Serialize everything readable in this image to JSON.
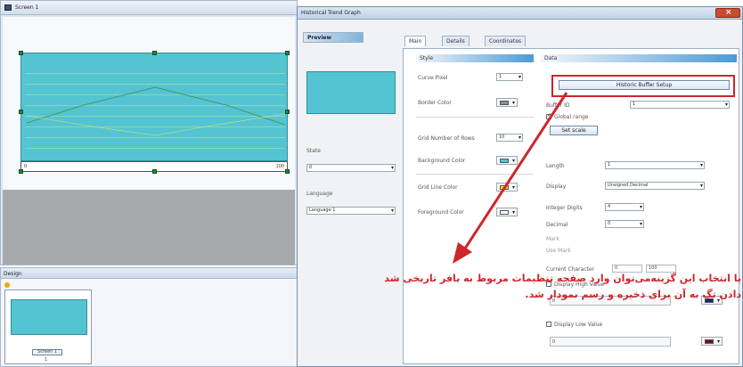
{
  "left_window": {
    "title": "Screen 1",
    "axis_left": "0",
    "axis_right": "100"
  },
  "thumbnail_panel": {
    "header": "Design",
    "screen_name": "Screen 1",
    "screen_number": "1"
  },
  "dialog": {
    "title": "Historical Trend Graph",
    "preview_tab": "Preview",
    "tabs": [
      "Main",
      "Details",
      "Coordinates"
    ],
    "left_col": {
      "state_label": "State",
      "state_value": "0",
      "language_label": "Language",
      "language_value": "Language 1"
    },
    "style_section": "Style",
    "style_fields": {
      "curve_pixel_label": "Curve Pixel",
      "curve_pixel_value": "1",
      "border_color_label": "Border Color",
      "grid_number_label": "Grid Number of Rows",
      "grid_number_value": "10",
      "background_label": "Background Color",
      "gridline_color_label": "Grid Line Color",
      "foreground_label": "Foreground Color"
    },
    "data_section": "Data",
    "data_fields": {
      "buffer_setup_button": "Historic Buffer Setup",
      "buffer_id_label": "Buffer ID",
      "buffer_id_value": "1",
      "global_range_label": "Global range",
      "set_scale_button": "Set scale",
      "length_label": "Length",
      "length_value": "1",
      "display_label": "Display",
      "display_value": "Unsigned Decimal",
      "integer_digits_label": "Integer Digits",
      "integer_digits_value": "4",
      "decimal_label": "Decimal",
      "decimal_value": "0",
      "mark_label": "Mark",
      "use_label": "Use Mark",
      "current_character_label": "Current Character",
      "current_character_value": "0",
      "current_character_max": "100",
      "display_high_label": "Display High Value",
      "display_high_value": "0",
      "display_low_label": "Display Low Value",
      "display_low_value": "0"
    },
    "colors": {
      "border": "#8a8f95",
      "background": "#55c4d2",
      "gridline": "#f2e21a",
      "foreground": "#ffffff",
      "high_value": "#1a237e",
      "low_value": "#6d1010"
    }
  },
  "annotation": {
    "line1": "با انتخاب این گزینه‌می‌توان وارد صفحه تنظیمات مربوط به بافر تاریخی شد",
    "line2": "دادن تگ به آن برای ذخیره و رسم نمودار شد."
  },
  "accent_red": "#d0252a"
}
